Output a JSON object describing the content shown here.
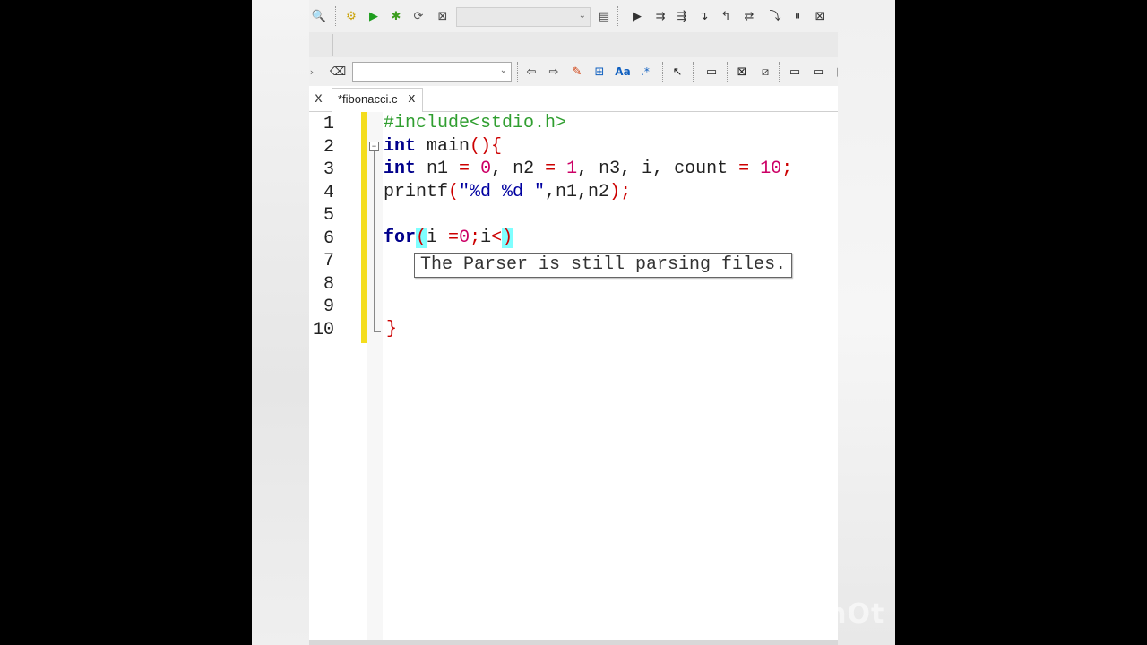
{
  "tab": {
    "title": "*fibonacci.c",
    "close_glyph": "x"
  },
  "toolbars": {
    "build_target_value": "",
    "search_value": ""
  },
  "editor": {
    "line_numbers": [
      "1",
      "2",
      "3",
      "4",
      "5",
      "6",
      "7",
      "8",
      "9",
      "10"
    ],
    "lines": [
      {
        "tokens": [
          {
            "t": "#include<stdio.h>",
            "c": "pp"
          }
        ]
      },
      {
        "tokens": [
          {
            "t": "int",
            "c": "kw"
          },
          {
            "t": " main",
            "c": ""
          },
          {
            "t": "(){",
            "c": "op"
          }
        ]
      },
      {
        "tokens": [
          {
            "t": "int",
            "c": "kw"
          },
          {
            "t": " n1 ",
            "c": ""
          },
          {
            "t": "=",
            "c": "op"
          },
          {
            "t": " ",
            "c": ""
          },
          {
            "t": "0",
            "c": "num"
          },
          {
            "t": ", n2 ",
            "c": ""
          },
          {
            "t": "=",
            "c": "op"
          },
          {
            "t": " ",
            "c": ""
          },
          {
            "t": "1",
            "c": "num"
          },
          {
            "t": ", n3, i, count ",
            "c": ""
          },
          {
            "t": "=",
            "c": "op"
          },
          {
            "t": " ",
            "c": ""
          },
          {
            "t": "10",
            "c": "num"
          },
          {
            "t": ";",
            "c": "op"
          }
        ]
      },
      {
        "tokens": [
          {
            "t": "printf",
            "c": ""
          },
          {
            "t": "(",
            "c": "op"
          },
          {
            "t": "\"%d %d \"",
            "c": "str"
          },
          {
            "t": ",n1,n2",
            "c": ""
          },
          {
            "t": ");",
            "c": "op"
          }
        ]
      },
      {
        "tokens": []
      },
      {
        "tokens": [
          {
            "t": "for",
            "c": "kw"
          },
          {
            "t": "(",
            "c": "op match"
          },
          {
            "t": "i ",
            "c": ""
          },
          {
            "t": "=",
            "c": "op"
          },
          {
            "t": "0",
            "c": "num"
          },
          {
            "t": ";",
            "c": "op"
          },
          {
            "t": "i",
            "c": ""
          },
          {
            "t": "<",
            "c": "op"
          },
          {
            "t": ")",
            "c": "op match"
          }
        ]
      },
      {
        "tokens": []
      },
      {
        "tokens": []
      },
      {
        "tokens": []
      },
      {
        "tokens": [
          {
            "t": "}",
            "c": "op"
          }
        ]
      }
    ],
    "tooltip": "The Parser is still parsing files."
  },
  "watermark": "InShOt",
  "colors": {
    "changebar": "#f4dd1e",
    "brace_match": "#7fffff",
    "keyword": "#00008b",
    "number": "#cc0066",
    "preprocessor": "#2f9e2f"
  }
}
